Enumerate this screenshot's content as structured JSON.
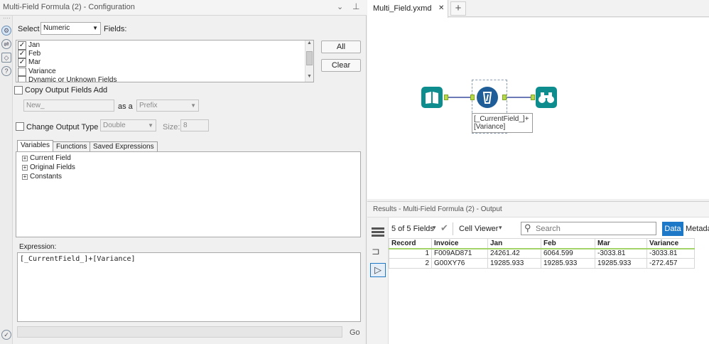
{
  "config": {
    "title": "Multi-Field Formula (2) - Configuration",
    "select_label": "Select",
    "select_value": "Numeric",
    "fields_label": "Fields:",
    "fields": [
      {
        "label": "Jan",
        "checked": true
      },
      {
        "label": "Feb",
        "checked": true
      },
      {
        "label": "Mar",
        "checked": true
      },
      {
        "label": "Variance",
        "checked": false
      },
      {
        "label": "Dynamic or Unknown Fields",
        "checked": false
      }
    ],
    "all_button": "All",
    "clear_button": "Clear",
    "copy_output_label": "Copy Output Fields Add",
    "copy_name_value": "New_",
    "as_a_label": "as a",
    "position_value": "Prefix",
    "change_type_label": "Change Output Type to",
    "type_value": "Double",
    "size_label": "Size:",
    "size_value": "8",
    "tabs": [
      "Variables",
      "Functions",
      "Saved Expressions"
    ],
    "tree": [
      "Current Field",
      "Original Fields",
      "Constants"
    ],
    "expression_label": "Expression:",
    "expression_value": "[_CurrentField_]+[Variance]",
    "go_label": "Go"
  },
  "document_tab": {
    "name": "Multi_Field.yxmd",
    "close": "✕",
    "new_tab": "+"
  },
  "workflow": {
    "formula_annotation_line1": "[_CurrentField_]+",
    "formula_annotation_line2": "[Variance]"
  },
  "results": {
    "title": "Results - Multi-Field Formula (2) - Output",
    "fields_count": "5 of 5 Fields",
    "cell_viewer": "Cell Viewer",
    "search_placeholder": "Search",
    "data_tab": "Data",
    "metadata_tab": "Metada",
    "columns": [
      "Record",
      "Invoice",
      "Jan",
      "Feb",
      "Mar",
      "Variance"
    ],
    "rows": [
      [
        "1",
        "F009AD871",
        "24261.42",
        "6064.599",
        "-3033.81",
        "-3033.81"
      ],
      [
        "2",
        "G00XY76",
        "19285.933",
        "19285.933",
        "19285.933",
        "-272.457"
      ]
    ]
  },
  "colors": {
    "input_tool": "#0e8d8f",
    "formula_tool": "#1e5d97",
    "browse_tool": "#0e8d8f",
    "accent_blue": "#1e78c8",
    "connector": "#3c4ea0"
  }
}
